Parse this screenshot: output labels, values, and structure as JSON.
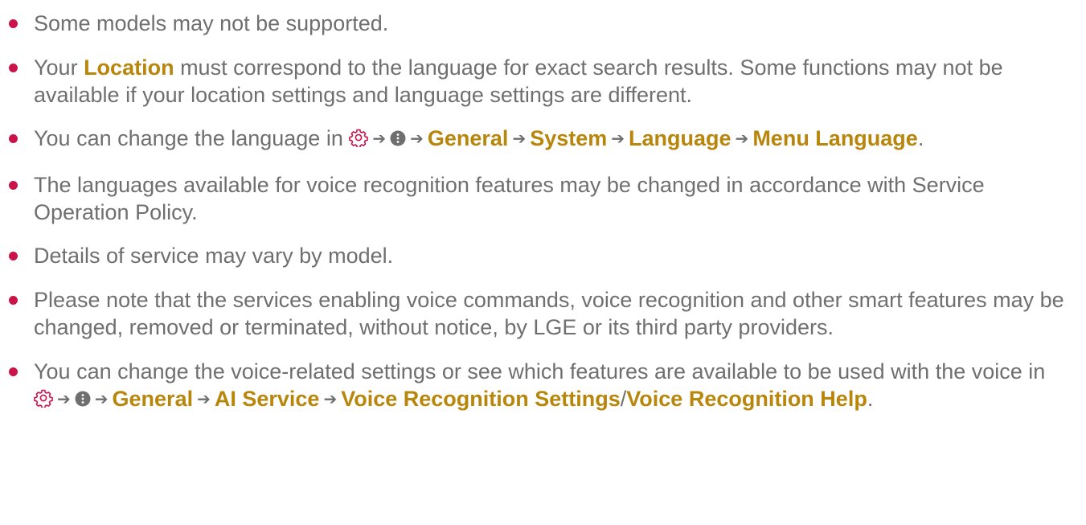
{
  "colors": {
    "bullet": "#c9144a",
    "text": "#6f6f6f",
    "highlight": "#b8860b"
  },
  "icons": {
    "settings": "gear-icon",
    "more": "more-options-icon",
    "arrow": "arrow-right"
  },
  "arrow_glyph": "➔",
  "notes": {
    "n1": {
      "text": "Some models may not be supported."
    },
    "n2": {
      "t1": "Your ",
      "location": "Location",
      "t2": " must correspond to the language for exact search results. Some functions may not be available if your location settings and language settings are different."
    },
    "n3": {
      "t1": "You can change the language in ",
      "general": "General",
      "system": "System",
      "language": "Language",
      "menu_language": "Menu Language",
      "end": "."
    },
    "n4": {
      "text": "The languages available for voice recognition features may be changed in accordance with Service Operation Policy."
    },
    "n5": {
      "text": "Details of service may vary by model."
    },
    "n6": {
      "text": "Please note that the services enabling voice commands, voice recognition and other smart features may be changed, removed or terminated, without notice, by LGE or its third party providers."
    },
    "n7": {
      "t1": "You can change the voice-related settings or see which features are available to be used with the voice in ",
      "general": "General",
      "ai_service": "AI Service",
      "voice_settings": "Voice Recognition Settings",
      "slash": "/",
      "voice_help": "Voice Recognition Help",
      "end": "."
    }
  }
}
